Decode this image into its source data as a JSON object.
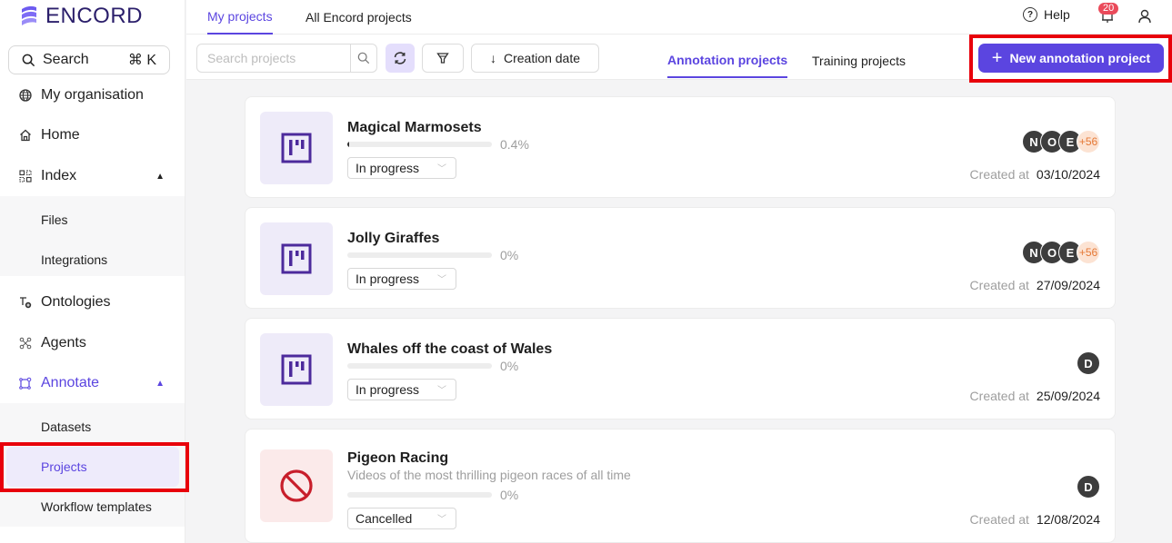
{
  "brand": {
    "name": "ENCORD",
    "accent": "#5b45e0"
  },
  "sidebar": {
    "search_label": "Search",
    "search_shortcut": "⌘ K",
    "items": [
      {
        "label": "My organisation",
        "icon": "globe-icon"
      },
      {
        "label": "Home",
        "icon": "home-icon"
      },
      {
        "label": "Index",
        "icon": "grid-icon",
        "expanded": true,
        "children": [
          "Files",
          "Integrations"
        ]
      },
      {
        "label": "Ontologies",
        "icon": "ontology-icon"
      },
      {
        "label": "Agents",
        "icon": "agents-icon"
      },
      {
        "label": "Annotate",
        "icon": "annotate-icon",
        "expanded": true,
        "active": true,
        "children": [
          "Datasets",
          "Projects",
          "Workflow templates"
        ]
      }
    ],
    "index_children": [
      "Files",
      "Integrations"
    ],
    "annotate_children": [
      "Datasets",
      "Projects",
      "Workflow templates"
    ],
    "selected": "Projects"
  },
  "topbar": {
    "tabs": [
      {
        "label": "My projects",
        "active": true
      },
      {
        "label": "All Encord projects",
        "active": false
      }
    ],
    "help_label": "Help",
    "notification_count": "20"
  },
  "toolbar": {
    "search_placeholder": "Search projects",
    "sort_label": "Creation date",
    "project_tabs": [
      {
        "label": "Annotation projects",
        "active": true
      },
      {
        "label": "Training projects",
        "active": false
      }
    ],
    "new_button_label": "New annotation project"
  },
  "projects": [
    {
      "title": "Magical Marmosets",
      "description": "",
      "progress_pct": 0.4,
      "progress_label": "0.4%",
      "status": "In progress",
      "avatars": [
        "N",
        "O",
        "E"
      ],
      "more": "+56",
      "created_label": "Created at",
      "created": "03/10/2024"
    },
    {
      "title": "Jolly Giraffes",
      "description": "",
      "progress_pct": 0,
      "progress_label": "0%",
      "status": "In progress",
      "avatars": [
        "N",
        "O",
        "E"
      ],
      "more": "+56",
      "created_label": "Created at",
      "created": "27/09/2024"
    },
    {
      "title": "Whales off the coast of Wales",
      "description": "",
      "progress_pct": 0,
      "progress_label": "0%",
      "status": "In progress",
      "avatars": [
        "D"
      ],
      "more": "",
      "created_label": "Created at",
      "created": "25/09/2024"
    },
    {
      "title": "Pigeon Racing",
      "description": "Videos of the most thrilling pigeon races of all time",
      "progress_pct": 0,
      "progress_label": "0%",
      "status": "Cancelled",
      "avatars": [
        "D"
      ],
      "more": "",
      "created_label": "Created at",
      "created": "12/08/2024"
    }
  ]
}
